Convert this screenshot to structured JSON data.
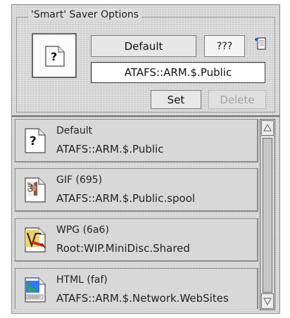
{
  "window": {
    "title": "'Smart' Saver Options"
  },
  "options": {
    "selected_name": "Default",
    "type_code": "???",
    "path": "ATAFS::ARM.$.Public",
    "set_label": "Set",
    "delete_label": "Delete",
    "preview_icon": "question-file-icon",
    "add_icon": "add-file-icon"
  },
  "list": {
    "items": [
      {
        "label": "Default",
        "path": "ATAFS::ARM.$.Public",
        "icon": "question-file-icon"
      },
      {
        "label": "GIF (695)",
        "path": "ATAFS::ARM.$.Public.spool",
        "icon": "gif-file-icon"
      },
      {
        "label": "WPG (6a6)",
        "path": "Root:WIP.MiniDisc.Shared",
        "icon": "wpg-file-icon"
      },
      {
        "label": "HTML (faf)",
        "path": "ATAFS::ARM.$.Network.WebSites",
        "icon": "html-file-icon"
      }
    ]
  },
  "scrollbar": {
    "up_icon": "scroll-up-icon",
    "down_icon": "scroll-down-icon"
  },
  "colors": {
    "window_background": "#dcdcdc",
    "border": "#8e8e8e",
    "disabled_text": "#a4a4a4",
    "accent_blue": "#1d58d8",
    "accent_red": "#cc2e1f"
  }
}
